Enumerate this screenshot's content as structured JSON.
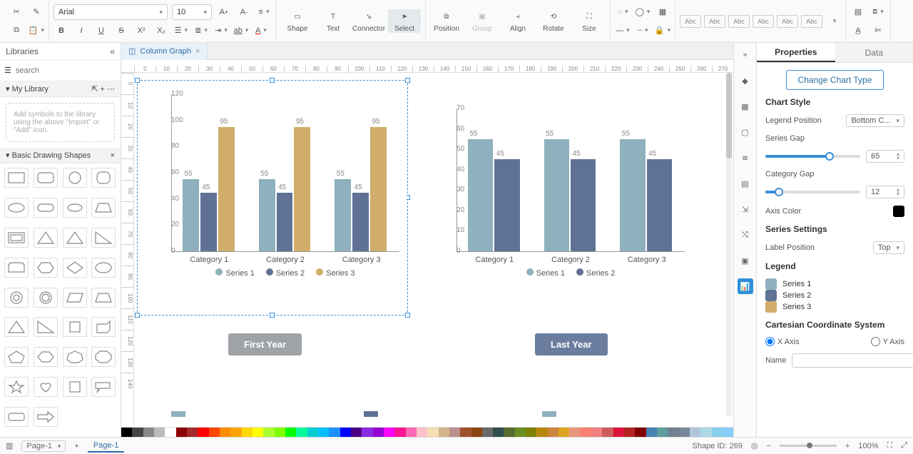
{
  "toolbar": {
    "font": "Arial",
    "font_size": "10",
    "shape": "Shape",
    "text": "Text",
    "connector": "Connector",
    "select": "Select",
    "position": "Position",
    "group": "Group",
    "align": "Align",
    "rotate": "Rotate",
    "size": "Size",
    "style_label": "Abc"
  },
  "left": {
    "libraries": "Libraries",
    "search_ph": "search",
    "mylib": "My Library",
    "hint": "Add symbols to the library using the above \"Import\" or \"Add\" icon.",
    "basic": "Basic Drawing Shapes"
  },
  "tabs": {
    "name": "Column Graph"
  },
  "chart_data": [
    {
      "type": "bar",
      "title": "First Year",
      "categories": [
        "Category 1",
        "Category 2",
        "Category 3"
      ],
      "series": [
        {
          "name": "Series 1",
          "values": [
            55,
            55,
            55
          ],
          "color": "#8fb0bd"
        },
        {
          "name": "Series 2",
          "values": [
            45,
            45,
            45
          ],
          "color": "#5f7296"
        },
        {
          "name": "Series 3",
          "values": [
            95,
            95,
            95
          ],
          "color": "#d0ad6a"
        }
      ],
      "ylim": [
        0,
        120
      ],
      "yticks": [
        0,
        20,
        40,
        60,
        80,
        100,
        120
      ]
    },
    {
      "type": "bar",
      "title": "Last Year",
      "categories": [
        "Category 1",
        "Category 2",
        "Category 3"
      ],
      "series": [
        {
          "name": "Series 1",
          "values": [
            55,
            55,
            55
          ],
          "color": "#8fb0bd"
        },
        {
          "name": "Series 2",
          "values": [
            45,
            45,
            45
          ],
          "color": "#5f7296"
        }
      ],
      "ylim": [
        0,
        70
      ],
      "yticks": [
        0,
        10,
        20,
        30,
        40,
        50,
        60,
        70
      ]
    }
  ],
  "right": {
    "tab_props": "Properties",
    "tab_data": "Data",
    "change_type": "Change Chart Type",
    "chart_style": "Chart Style",
    "legend_pos": "Legend Position",
    "legend_pos_val": "Bottom C...",
    "series_gap": "Series Gap",
    "series_gap_val": "65",
    "category_gap": "Category Gap",
    "category_gap_val": "12",
    "axis_color": "Axis Color",
    "axis_color_val": "#000000",
    "series_settings": "Series Settings",
    "label_pos": "Label Position",
    "label_pos_val": "Top",
    "legend": "Legend",
    "legend_items": [
      {
        "name": "Series 1",
        "color": "#8fb0bd"
      },
      {
        "name": "Series 2",
        "color": "#5f7296"
      },
      {
        "name": "Series 3",
        "color": "#d0ad6a"
      }
    ],
    "cartesian": "Cartesian Coordinate System",
    "xaxis": "X Axis",
    "yaxis": "Y Axis",
    "name": "Name"
  },
  "status": {
    "page_sel": "Page-1",
    "page_tab": "Page-1",
    "shape_id": "Shape ID: 269",
    "zoom": "100%"
  },
  "ruler_h": [
    0,
    10,
    20,
    30,
    40,
    50,
    60,
    70,
    80,
    90,
    100,
    110,
    120,
    130,
    140,
    150,
    160,
    170,
    180,
    190,
    200,
    210,
    220,
    230,
    240,
    250,
    260,
    270
  ],
  "ruler_v": [
    0,
    10,
    20,
    30,
    40,
    50,
    60,
    70,
    80,
    90,
    100,
    110,
    120,
    130,
    140
  ]
}
